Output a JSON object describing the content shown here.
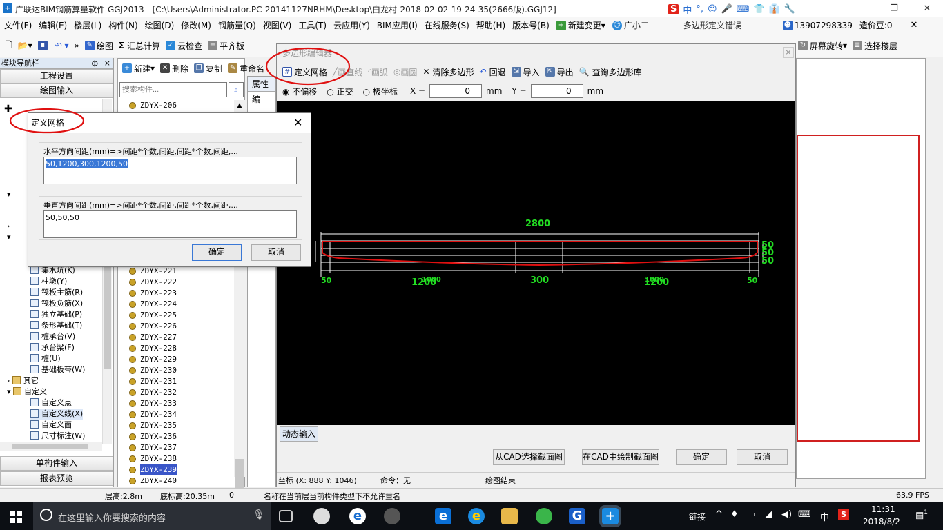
{
  "window": {
    "title": "广联达BIM钢筋算量软件 GGJ2013 - [C:\\Users\\Administrator.PC-20141127NRHM\\Desktop\\白龙村-2018-02-02-19-24-35(2666版).GGJ12]",
    "ime": [
      "中",
      "°,",
      "☺",
      "🎤",
      "⌨",
      "👕",
      "👔",
      "🔧"
    ]
  },
  "menu": [
    "文件(F)",
    "编辑(E)",
    "楼层(L)",
    "构件(N)",
    "绘图(D)",
    "修改(M)",
    "钢筋量(Q)",
    "视图(V)",
    "工具(T)",
    "云应用(Y)",
    "BIM应用(I)",
    "在线服务(S)",
    "帮助(H)",
    "版本号(B)",
    "新建变更",
    "广小二"
  ],
  "error_text": "多边形定义错误",
  "account": {
    "phone": "13907298339",
    "points": "造价豆:0"
  },
  "toolbar": {
    "draw": "绘图",
    "sum": "汇总计算",
    "cloud": "云检查",
    "flat": "平齐板",
    "rotate": "屏幕旋转",
    "floor": "选择楼层"
  },
  "nav": {
    "header": "模块导航栏",
    "pin": "ф",
    "close": "×",
    "project_settings": "工程设置",
    "drawing_input": "绘图输入",
    "single_input": "单构件输入",
    "report_preview": "报表预览",
    "items": [
      "集水坑(K)",
      "柱墩(Y)",
      "筏板主筋(R)",
      "筏板负筋(X)",
      "独立基础(P)",
      "条形基础(T)",
      "桩承台(V)",
      "承台梁(F)",
      "桩(U)",
      "基础板带(W)"
    ],
    "folders": [
      "其它",
      "自定义"
    ],
    "custom_items": [
      "自定义点",
      "自定义线(X)",
      "自定义面",
      "尺寸标注(W)"
    ]
  },
  "components": {
    "new": "新建",
    "delete": "删除",
    "copy": "复制",
    "rename": "重命名",
    "search_placeholder": "搜索构件...",
    "props_tab": "属性编",
    "top_item": "ZDYX-206",
    "items": [
      "ZDYX-221",
      "ZDYX-222",
      "ZDYX-223",
      "ZDYX-224",
      "ZDYX-225",
      "ZDYX-226",
      "ZDYX-227",
      "ZDYX-228",
      "ZDYX-229",
      "ZDYX-230",
      "ZDYX-231",
      "ZDYX-232",
      "ZDYX-233",
      "ZDYX-234",
      "ZDYX-235",
      "ZDYX-236",
      "ZDYX-237",
      "ZDYX-238",
      "ZDYX-239",
      "ZDYX-240"
    ],
    "selected": "ZDYX-239"
  },
  "poly_editor": {
    "title": "多边形编辑器",
    "tools": [
      "定义网格",
      "画直线",
      "画弧",
      "画圆",
      "清除多边形",
      "回退",
      "导入",
      "导出",
      "查询多边形库"
    ],
    "offset_options": [
      "不偏移",
      "正交",
      "极坐标"
    ],
    "x_label": "X =",
    "x_value": "0",
    "x_unit": "mm",
    "y_label": "Y =",
    "y_value": "0",
    "y_unit": "mm",
    "dynamic_input": "动态输入",
    "btn_select_cad": "从CAD选择截面图",
    "btn_draw_cad": "在CAD中绘制截面图",
    "btn_ok": "确定",
    "btn_cancel": "取消",
    "coord": "坐标 (X: 888 Y: 1046)",
    "command": "命令：无",
    "status": "绘图结束",
    "dims": {
      "total": "2800",
      "left": "50",
      "right": "50",
      "d1": "1200",
      "d2": "300",
      "d3": "1200",
      "d1_dup": "1000",
      "d3_dup": "1000",
      "vert": [
        "50",
        "50",
        "50"
      ]
    }
  },
  "grid_dialog": {
    "title": "定义网格",
    "h_label": "水平方向间距(mm)=>间距*个数,间距,间距*个数,间距,...",
    "h_value": "50,1200,300,1200,50",
    "v_label": "垂直方向间距(mm)=>间距*个数,间距,间距*个数,间距,...",
    "v_value": "50,50,50",
    "ok": "确定",
    "cancel": "取消"
  },
  "statusbar": {
    "floor_height": "层高:2.8m",
    "base_height": "底标高:20.35m",
    "zero": "0",
    "message": "名称在当前层当前构件类型下不允许重名",
    "fps": "63.9 FPS"
  },
  "taskbar": {
    "search": "在这里输入你要搜索的内容",
    "link": "链接",
    "lang": "中",
    "time": "11:31",
    "date": "2018/8/2",
    "notif": "1"
  }
}
